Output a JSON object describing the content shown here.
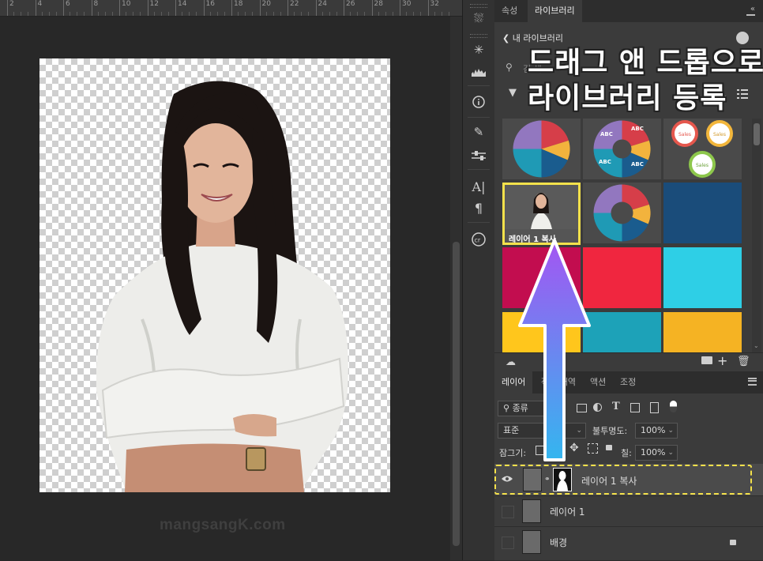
{
  "ruler": {
    "ticks": [
      "2",
      "4",
      "6",
      "8",
      "10",
      "12",
      "14",
      "16",
      "18",
      "20",
      "22",
      "24",
      "26",
      "28",
      "30",
      "32"
    ]
  },
  "watermark": "mangsangK.com",
  "panels": {
    "top_tabs": [
      "속성",
      "라이브러리"
    ],
    "library": {
      "back_label": "내 라이브러리",
      "search_placeholder": "검 색",
      "view_label": "/...",
      "overlay_line1": "드래그 앤 드롭으로",
      "overlay_line2": "라이브러리 등록",
      "pie_labels": [
        "ABC",
        "ABC",
        "ABC",
        "ABC"
      ],
      "donut_labels": [
        "Sales",
        "Sales",
        "Sales"
      ],
      "highlight_item_label": "레이어 1 복사",
      "colors": {
        "pie": [
          "#d63e49",
          "#f2b33d",
          "#1a5c8e",
          "#1f9ab5",
          "#9277bf"
        ],
        "tiles": [
          "#1a4c7a",
          "#c20d4f",
          "#f0263f",
          "#2ecfe6",
          "#ffc61c",
          "#1da2b8",
          "#f5b323"
        ],
        "highlight": "#f4e14b",
        "arrow_top": "#a455f2",
        "arrow_bottom": "#34b6ef"
      }
    },
    "layers": {
      "tabs": [
        "레이어",
        "작업 내역",
        "액션",
        "조정"
      ],
      "filter_label": "종류",
      "blend_mode": "표준",
      "opacity_label": "불투명도:",
      "opacity_value": "100%",
      "lock_label": "잠그기:",
      "fill_label": "칠:",
      "fill_value": "100%",
      "items": [
        {
          "name": "레이어 1 복사",
          "visible": true,
          "selected": true
        },
        {
          "name": "레이어 1",
          "visible": false,
          "selected": false
        },
        {
          "name": "배경",
          "visible": false,
          "selected": false,
          "locked": true
        }
      ]
    }
  }
}
